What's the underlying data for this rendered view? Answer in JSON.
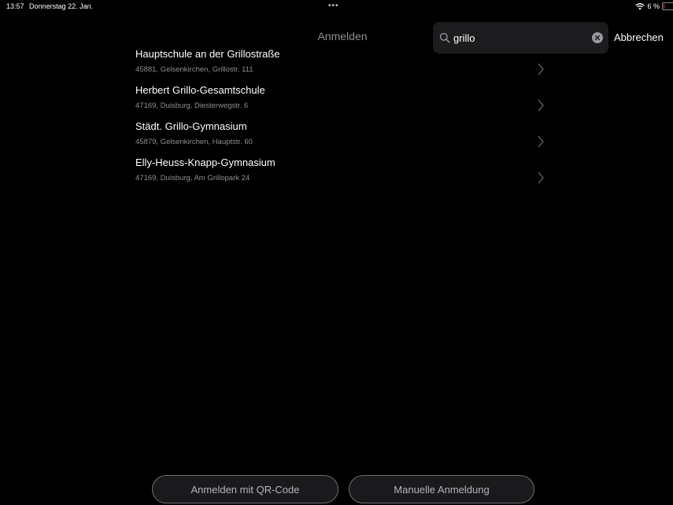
{
  "status_bar": {
    "time": "13:57",
    "date": "Donnerstag 22. Jan.",
    "multitask_dots": "•••",
    "battery_percent": "6 %",
    "battery_level": 0.06,
    "wifi_icon": "wifi-icon",
    "battery_icon": "battery-low-icon",
    "battery_color": "#ff3b30"
  },
  "nav": {
    "title": "Anmelden",
    "cancel_label": "Abbrechen"
  },
  "search": {
    "value": "grillo",
    "search_icon": "search-icon",
    "clear_icon": "clear-icon"
  },
  "results": [
    {
      "title": "Hauptschule an der Grillostraße",
      "subtitle": "45881, Gelsenkirchen, Grillostr. 111"
    },
    {
      "title": "Herbert Grillo-Gesamtschule",
      "subtitle": "47169, Duisburg, Diesterwegstr. 6"
    },
    {
      "title": "Städt. Grillo-Gymnasium",
      "subtitle": "45879, Gelsenkirchen, Hauptstr. 60"
    },
    {
      "title": "Elly-Heuss-Knapp-Gymnasium",
      "subtitle": "47169, Duisburg, Am Grillopark 24"
    }
  ],
  "bottom": {
    "qr_label": "Anmelden mit QR-Code",
    "manual_label": "Manuelle Anmeldung"
  },
  "colors": {
    "background": "#000000",
    "secondary_text": "#8e8e93",
    "search_background": "#1c1c1e"
  }
}
